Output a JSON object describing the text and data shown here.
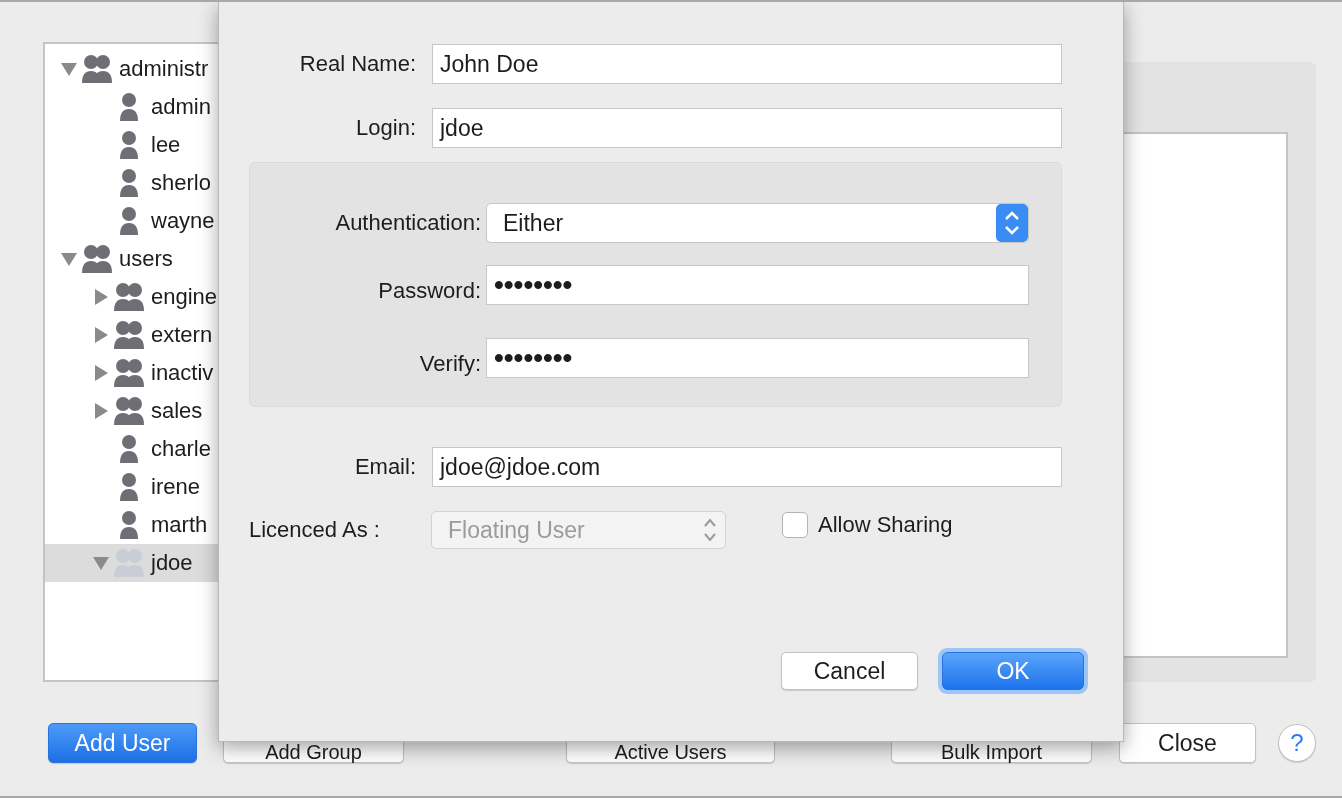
{
  "tree": {
    "items": [
      {
        "label": "administr",
        "kind": "group",
        "expanded": true,
        "selected": false,
        "dimmed": false,
        "children": [
          {
            "label": "admin",
            "kind": "user",
            "selected": false
          },
          {
            "label": "lee",
            "kind": "user",
            "selected": false
          },
          {
            "label": "sherlo",
            "kind": "user",
            "selected": false
          },
          {
            "label": "wayne",
            "kind": "user",
            "selected": false
          }
        ]
      },
      {
        "label": "users",
        "kind": "group",
        "expanded": true,
        "selected": false,
        "dimmed": false,
        "children": [
          {
            "label": "engine",
            "kind": "group",
            "expanded": false,
            "selected": false,
            "dimmed": false
          },
          {
            "label": "extern",
            "kind": "group",
            "expanded": false,
            "selected": false,
            "dimmed": false
          },
          {
            "label": "inactiv",
            "kind": "group",
            "expanded": false,
            "selected": false,
            "dimmed": false
          },
          {
            "label": "sales",
            "kind": "group",
            "expanded": false,
            "selected": false,
            "dimmed": false
          },
          {
            "label": "charle",
            "kind": "user",
            "selected": false
          },
          {
            "label": "irene",
            "kind": "user",
            "selected": false
          },
          {
            "label": "marth",
            "kind": "user",
            "selected": false
          },
          {
            "label": "jdoe",
            "kind": "group",
            "expanded": true,
            "selected": true,
            "dimmed": true
          }
        ]
      }
    ]
  },
  "buttons": [
    {
      "label": "Add User",
      "primary": true
    },
    {
      "label": "Add Group",
      "primary": false
    },
    {
      "label": "Active Users",
      "primary": false
    },
    {
      "label": "Bulk Import",
      "primary": false
    },
    {
      "label": "Close",
      "primary": false
    }
  ],
  "help_button": "?",
  "dialog": {
    "fields": [
      {
        "label": "Real Name:",
        "value": "John Doe"
      },
      {
        "label": "Login:",
        "value": "jdoe"
      }
    ],
    "auth_group": {
      "authentication": {
        "label": "Authentication:",
        "value": "Either"
      },
      "password": {
        "label": "Password:",
        "value": "••••••••"
      },
      "verify": {
        "label": "Verify:",
        "value": "••••••••"
      }
    },
    "email": {
      "label": "Email:",
      "value": "jdoe@jdoe.com"
    },
    "licence": {
      "label": "Licenced As :",
      "value": "Floating User",
      "disabled": true
    },
    "allow_sharing": {
      "label": "Allow Sharing",
      "checked": false
    },
    "buttons": [
      {
        "label": "Cancel",
        "default": false
      },
      {
        "label": "OK",
        "default": true
      }
    ]
  }
}
